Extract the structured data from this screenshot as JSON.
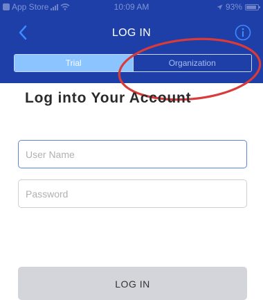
{
  "status_bar": {
    "carrier": "App Store",
    "time": "10:09 AM",
    "battery": "93%"
  },
  "nav": {
    "title": "LOG IN",
    "back_icon": "chevron-left-icon",
    "info_icon": "info-circle-icon"
  },
  "tabs": [
    {
      "label": "Trial",
      "selected": true
    },
    {
      "label": "Organization",
      "selected": false
    }
  ],
  "heading": "Log into Your Account",
  "form": {
    "username_placeholder": "User Name",
    "username_value": "",
    "password_placeholder": "Password",
    "password_value": "",
    "submit_label": "LOG IN"
  },
  "colors": {
    "header": "#1e3fa8",
    "tab_active": "#8cc4ff",
    "info_icon": "#3d8bff",
    "annotation": "#d93a3a",
    "button_disabled": "#d3d5da"
  }
}
